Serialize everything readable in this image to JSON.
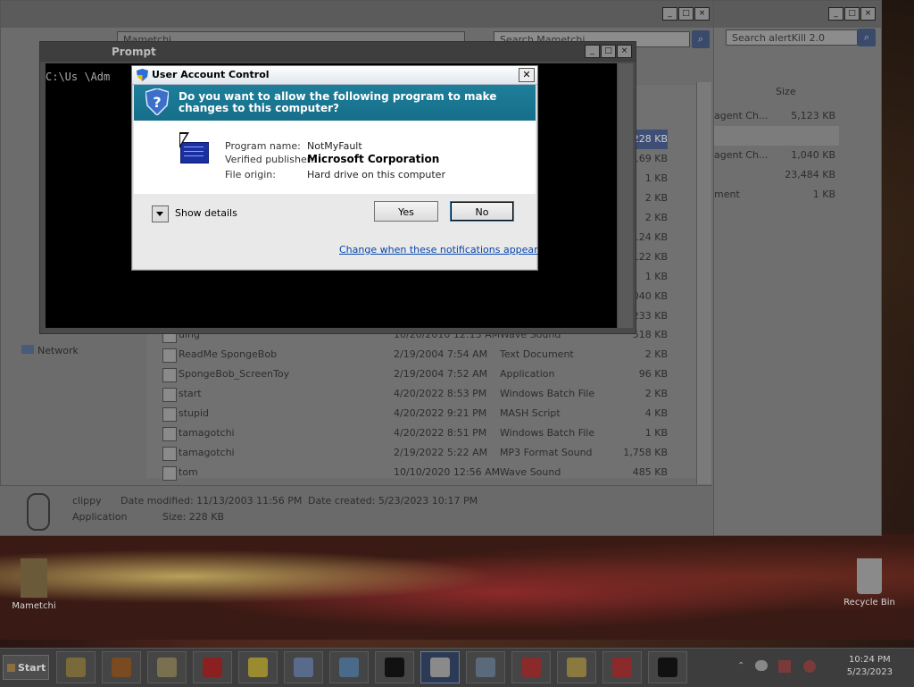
{
  "desktop": {
    "icons": [
      {
        "label": "Mametchi"
      },
      {
        "label": "Recycle Bin"
      }
    ]
  },
  "explorer": {
    "search_placeholder": "Search Mametchi",
    "breadcrumb": "Mametchi",
    "right_search_placeholder": "Search alertKill 2.0",
    "right_col_size": "Size",
    "right_rows": [
      {
        "name": "agent Ch...",
        "size": "5,123 KB"
      },
      {
        "name": "",
        "size": ""
      },
      {
        "name": "agent Ch...",
        "size": "1,040 KB"
      },
      {
        "name": "",
        "size": "23,484 KB"
      },
      {
        "name": "ment",
        "size": "1 KB"
      }
    ],
    "nav": {
      "network": "Network"
    },
    "size_column_partial": [
      "228 KB",
      ",169 KB",
      "1 KB",
      "2 KB",
      "2 KB",
      "124 KB",
      "122 KB",
      "1 KB",
      ",040 KB",
      "233 KB"
    ],
    "rows": [
      {
        "name": "ding",
        "date": "10/20/2010 12:13 AM",
        "type": "Wave Sound",
        "size": "518 KB"
      },
      {
        "name": "ReadMe SpongeBob",
        "date": "2/19/2004 7:54 AM",
        "type": "Text Document",
        "size": "2 KB"
      },
      {
        "name": "SpongeBob_ScreenToy",
        "date": "2/19/2004 7:52 AM",
        "type": "Application",
        "size": "96 KB"
      },
      {
        "name": "start",
        "date": "4/20/2022 8:53 PM",
        "type": "Windows Batch File",
        "size": "2 KB"
      },
      {
        "name": "stupid",
        "date": "4/20/2022 9:21 PM",
        "type": "MASH Script",
        "size": "4 KB"
      },
      {
        "name": "tamagotchi",
        "date": "4/20/2022 8:51 PM",
        "type": "Windows Batch File",
        "size": "1 KB"
      },
      {
        "name": "tamagotchi",
        "date": "2/19/2022 5:22 AM",
        "type": "MP3 Format Sound",
        "size": "1,758 KB"
      },
      {
        "name": "tom",
        "date": "10/10/2020 12:56 AM",
        "type": "Wave Sound",
        "size": "485 KB"
      }
    ],
    "details": {
      "name": "clippy",
      "kind": "Application",
      "modified_label": "Date modified:",
      "modified": "11/13/2003 11:56 PM",
      "created_label": "Date created:",
      "created": "5/23/2023 10:17 PM",
      "size_label": "Size:",
      "size": "228 KB"
    }
  },
  "cmd": {
    "title": "Prompt",
    "line": "C:\\Us     \\Adm"
  },
  "uac": {
    "title": "User Account Control",
    "question": "Do you want to allow the following program to make changes to this computer?",
    "program_label": "Program name:",
    "program_value": "NotMyFault",
    "publisher_label": "Verified publisher:",
    "publisher_value": "Microsoft Corporation",
    "origin_label": "File origin:",
    "origin_value": "Hard drive on this computer",
    "show_details": "Show details",
    "yes": "Yes",
    "no": "No",
    "link": "Change when these notifications appear"
  },
  "taskbar": {
    "start": "Start",
    "clock_time": "10:24 PM",
    "clock_date": "5/23/2023",
    "buttons": [
      {
        "icon": "chrome-icon",
        "color": "#7a6a3a"
      },
      {
        "icon": "firefox-icon",
        "color": "#7a4a20"
      },
      {
        "icon": "folder-icon",
        "color": "#7a7050"
      },
      {
        "icon": "yandex-icon",
        "color": "#8a2020"
      },
      {
        "icon": "sun-icon",
        "color": "#9a8a30"
      },
      {
        "icon": "document-icon",
        "color": "#5a6a8a"
      },
      {
        "icon": "network-icon",
        "color": "#4a6a8a"
      },
      {
        "icon": "cmd-icon",
        "color": "#111111"
      },
      {
        "icon": "calculator-icon",
        "color": "#8a8a8a"
      },
      {
        "icon": "lambda-icon",
        "color": "#5a6a7a"
      },
      {
        "icon": "toolbox-icon",
        "color": "#8a2a2a"
      },
      {
        "icon": "pencil-icon",
        "color": "#8a7a40"
      },
      {
        "icon": "toolbox-icon",
        "color": "#8a2a2a"
      },
      {
        "icon": "cmd-icon",
        "color": "#111111"
      }
    ]
  }
}
